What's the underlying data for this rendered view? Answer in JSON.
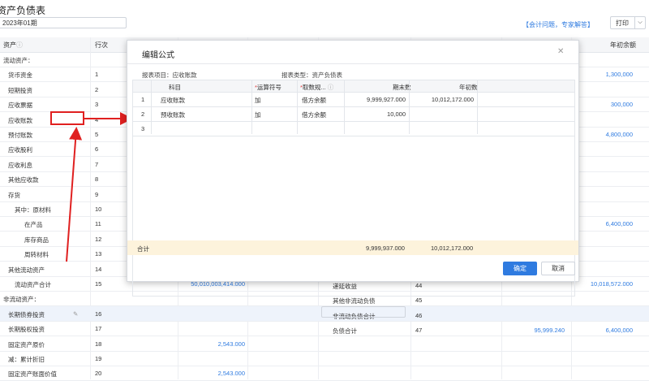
{
  "header": {
    "title": "资产负债表",
    "period": "2023年01期",
    "help_link": "【会计问题，专家解答】",
    "print_label": "打印"
  },
  "table": {
    "columns": [
      "资产",
      "行次",
      "年初余额"
    ],
    "rows": [
      {
        "name": "流动资产：",
        "line": "",
        "end": "",
        "begin": ""
      },
      {
        "name": "货币资金",
        "line": "1",
        "end": "",
        "begin": "1,300,000"
      },
      {
        "name": "短期投资",
        "line": "2",
        "end": "",
        "begin": ""
      },
      {
        "name": "应收票据",
        "line": "3",
        "end": "",
        "begin": "300,000"
      },
      {
        "name": "应收账款",
        "line": "4",
        "end": "",
        "begin": ""
      },
      {
        "name": "预付账款",
        "line": "5",
        "end": "",
        "begin": "4,800,000"
      },
      {
        "name": "应收股利",
        "line": "6",
        "end": "",
        "begin": ""
      },
      {
        "name": "应收利息",
        "line": "7",
        "end": "",
        "begin": ""
      },
      {
        "name": "其他应收款",
        "line": "8",
        "end": "",
        "begin": ""
      },
      {
        "name": "存货",
        "line": "9",
        "end": "",
        "begin": ""
      },
      {
        "name": "其中：原材料",
        "line": "10",
        "end": "",
        "begin": ""
      },
      {
        "name": "在产品",
        "line": "11",
        "end": "",
        "begin": "6,400,000"
      },
      {
        "name": "库存商品",
        "line": "12",
        "end": "",
        "begin": ""
      },
      {
        "name": "周转材料",
        "line": "13",
        "end": "",
        "begin": ""
      },
      {
        "name": "其他流动资产",
        "line": "14",
        "end": "",
        "begin": ""
      },
      {
        "name": "流动资产合计",
        "line": "15",
        "end": "50,010,003,414.000",
        "begin": "10,018,572.000"
      },
      {
        "name": "非流动资产：",
        "line": "",
        "end": "",
        "begin": ""
      },
      {
        "name": "长期债券投资",
        "line": "16",
        "end": "",
        "begin": ""
      },
      {
        "name": "长期股权投资",
        "line": "17",
        "end": "",
        "begin": ""
      },
      {
        "name": "固定资产原价",
        "line": "18",
        "end": "2,543.000",
        "begin": ""
      },
      {
        "name": "减：累计折旧",
        "line": "19",
        "end": "",
        "begin": ""
      },
      {
        "name": "固定资产账面价值",
        "line": "20",
        "end": "2,543.000",
        "begin": ""
      }
    ],
    "right_rows": [
      {
        "name": "递延收益",
        "line": "44",
        "v1": "",
        "v2": ""
      },
      {
        "name": "其他非流动负债",
        "line": "45",
        "v1": "",
        "v2": ""
      },
      {
        "name": "非流动负债合计",
        "line": "46",
        "v1": "",
        "v2": ""
      },
      {
        "name": "负债合计",
        "line": "47",
        "v1": "95,999.240",
        "v2": "6,400,000"
      }
    ]
  },
  "modal": {
    "title": "编辑公式",
    "report_item": "报表项目：应收账款",
    "report_type": "报表类型：资产负债表",
    "columns": [
      "科目",
      "运算符号",
      "取数规...",
      "期末数",
      "年初数"
    ],
    "rows": [
      {
        "no": "1",
        "subject": "应收账款",
        "op": "加",
        "rule": "借方余额",
        "end": "9,999,927.000",
        "begin": "10,012,172.000"
      },
      {
        "no": "2",
        "subject": "预收账款",
        "op": "加",
        "rule": "借方余额",
        "end": "10,000",
        "begin": ""
      },
      {
        "no": "3",
        "subject": "",
        "op": "",
        "rule": "",
        "end": "",
        "begin": ""
      }
    ],
    "total_label": "合计",
    "total_end": "9,999,937.000",
    "total_begin": "10,012,172.000",
    "ok_label": "确定",
    "cancel_label": "取消"
  }
}
